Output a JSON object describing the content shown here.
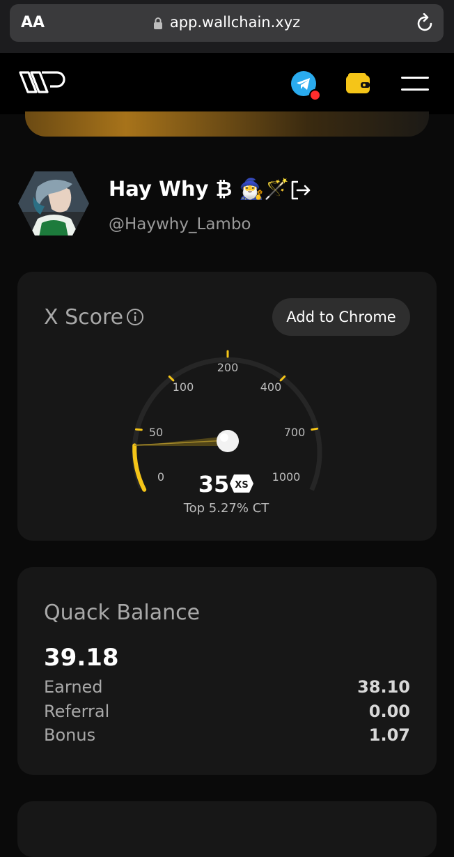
{
  "browser": {
    "aa_label": "AA",
    "url": "app.wallchain.xyz"
  },
  "header": {
    "icons": [
      "wallchain-logo",
      "telegram-icon",
      "wallet-icon",
      "menu-icon"
    ]
  },
  "profile": {
    "name": "Hay Why ₿ 🧙‍♂️🪄",
    "handle": "@Haywhy_Lambo"
  },
  "xscore": {
    "title": "X Score",
    "button": "Add to Chrome",
    "score": "35",
    "rank": "Top 5.27% CT",
    "ticks": [
      "0",
      "50",
      "100",
      "200",
      "400",
      "700",
      "1000"
    ],
    "colors": {
      "accent": "#f5c518",
      "track": "#262626"
    }
  },
  "quack": {
    "title": "Quack Balance",
    "total": "39.18",
    "rows": [
      {
        "label": "Earned",
        "value": "38.10"
      },
      {
        "label": "Referral",
        "value": "0.00"
      },
      {
        "label": "Bonus",
        "value": "1.07"
      }
    ]
  }
}
